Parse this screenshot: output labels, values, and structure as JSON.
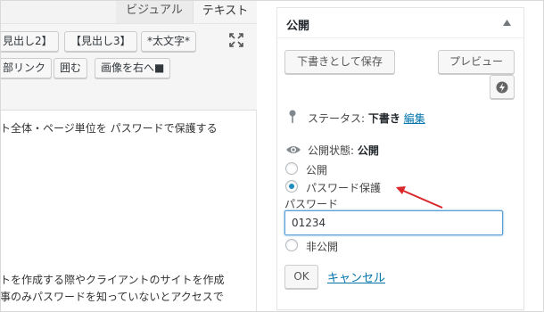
{
  "editor": {
    "tabs": [
      {
        "label": "ビジュアル"
      },
      {
        "label": "テキスト"
      }
    ],
    "toolbar_buttons": [
      {
        "label": "見出し2】"
      },
      {
        "label": "【見出し3】"
      },
      {
        "label": "*太文字*"
      },
      {
        "label": "部リンク"
      },
      {
        "label": "囲む"
      },
      {
        "label": "画像を右へ■"
      }
    ],
    "content_lines": [
      "ト全体・ページ単位を パスワードで保護する",
      "トを作成する際やクライアントのサイトを作成",
      "事のみパスワードを知っていないとアクセスで"
    ]
  },
  "publish": {
    "title": "公開",
    "save_draft_label": "下書きとして保存",
    "preview_label": "プレビュー",
    "status_label": "ステータス:",
    "status_value": "下書き",
    "status_edit_link": "編集",
    "visibility_label": "公開状態:",
    "visibility_value": "公開",
    "options": [
      {
        "label": "公開",
        "checked": false
      },
      {
        "label": "パスワード保護",
        "checked": true
      }
    ],
    "password_label": "パスワード",
    "password_value": "01234",
    "private_label": "非公開",
    "ok_label": "OK",
    "cancel_label": "キャンセル"
  },
  "colors": {
    "accent_blue": "#0073aa",
    "annotation_red": "#d9262a"
  }
}
